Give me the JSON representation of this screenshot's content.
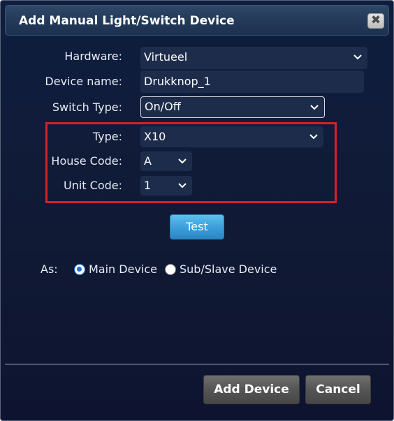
{
  "dialog": {
    "title": "Add Manual Light/Switch Device",
    "close_glyph": "✖"
  },
  "form": {
    "hardware": {
      "label": "Hardware:",
      "value": "Virtueel"
    },
    "device_name": {
      "label": "Device name:",
      "value": "Drukknop_1"
    },
    "switch_type": {
      "label": "Switch Type:",
      "value": "On/Off"
    },
    "type": {
      "label": "Type:",
      "value": "X10"
    },
    "house_code": {
      "label": "House Code:",
      "value": "A"
    },
    "unit_code": {
      "label": "Unit Code:",
      "value": "1"
    }
  },
  "test_button": "Test",
  "as": {
    "label": "As:",
    "options": [
      {
        "label": "Main Device",
        "selected": true
      },
      {
        "label": "Sub/Slave Device",
        "selected": false
      }
    ]
  },
  "footer": {
    "add_device": "Add Device",
    "cancel": "Cancel"
  },
  "colors": {
    "background": "#101a35",
    "highlight_border": "#d42228",
    "test_button": "#3a9ed9"
  },
  "icons": [
    "close-icon",
    "chevron-down-icon",
    "radio-icon"
  ]
}
